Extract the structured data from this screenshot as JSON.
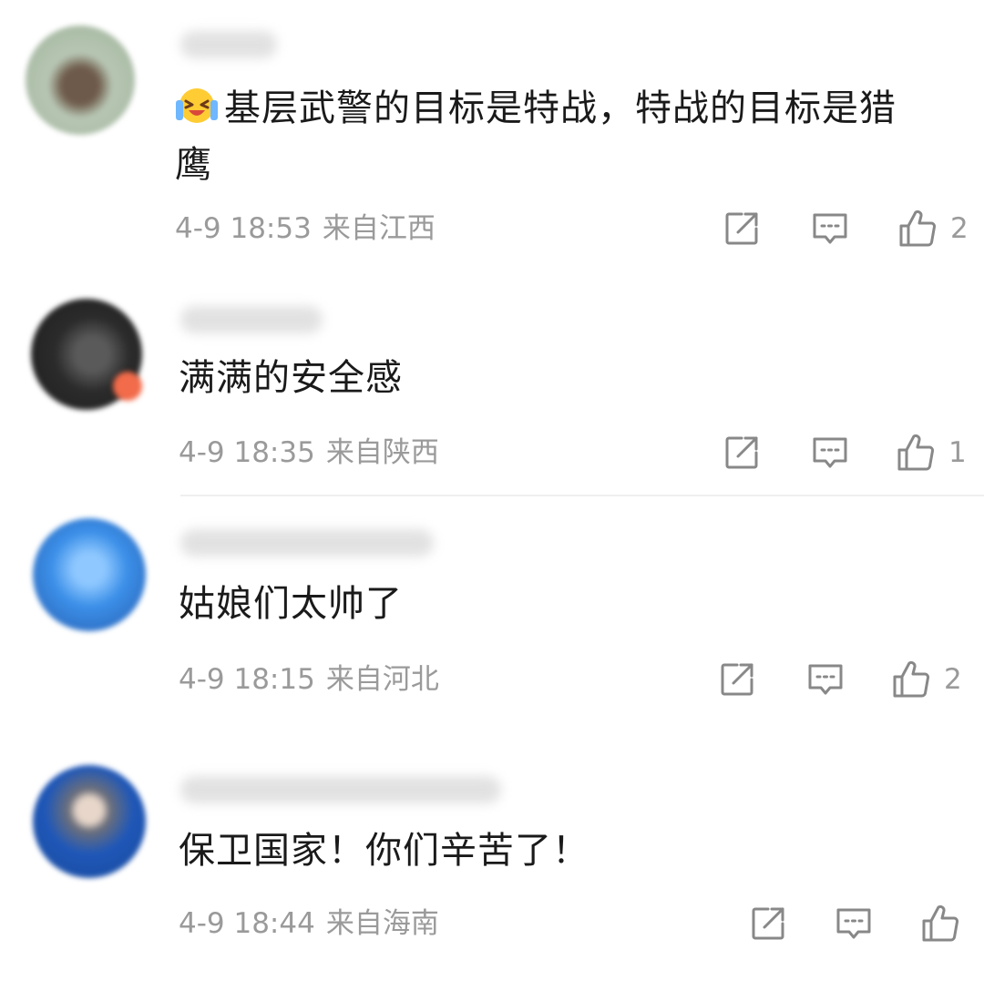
{
  "comments": [
    {
      "text_line1": "基层武警的目标是特战，特战的目标是猎",
      "text_line2": "鹰",
      "emoji": "laughing-crying-face-icon",
      "date_time": "4-9 18:53",
      "location": "来自江西",
      "likes": "2"
    },
    {
      "text": "满满的安全感",
      "date_time": "4-9 18:35",
      "location": "来自陕西",
      "likes": "1"
    },
    {
      "text": "姑娘们太帅了",
      "date_time": "4-9 18:15",
      "location": "来自河北",
      "likes": "2"
    },
    {
      "text": "保卫国家！你们辛苦了！",
      "date_time": "4-9 18:44",
      "location": "来自海南",
      "likes": ""
    }
  ],
  "icons": {
    "share": "share-icon",
    "reply": "comment-icon",
    "like": "thumbs-up-icon"
  },
  "colors": {
    "meta_text": "#9a9a9a",
    "icon_stroke": "#888888",
    "divider": "#efefef"
  }
}
